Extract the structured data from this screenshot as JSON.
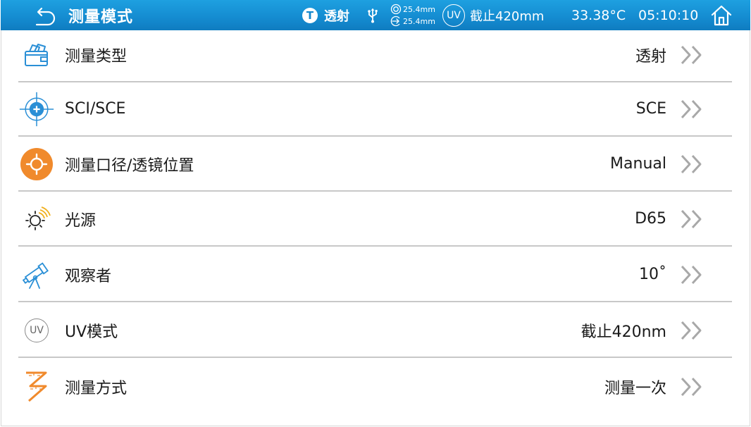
{
  "header": {
    "title": "测量模式",
    "mode_letter": "T",
    "mode_label": "透射",
    "aperture_top": "25.4mm",
    "aperture_bottom": "25.4mm",
    "uv_badge": "UV",
    "uv_label": "截止420mm",
    "temperature": "33.38°C",
    "time": "05:10:10",
    "icons": [
      "back-arrow-icon",
      "usb-icon",
      "aperture-icon",
      "lens-icon",
      "home-icon"
    ]
  },
  "colors": {
    "header_blue": "#148bd0",
    "accent_orange": "#f08a2c",
    "icon_blue": "#2a8fd6",
    "chevron_gray": "#a8a8a8"
  },
  "settings": [
    {
      "label": "测量类型",
      "value": "透射",
      "icon": "measure-type-icon"
    },
    {
      "label": "SCI/SCE",
      "value": "SCE",
      "icon": "target-crosshair-icon"
    },
    {
      "label": "测量口径/透镜位置",
      "value": "Manual",
      "icon": "aperture-position-icon"
    },
    {
      "label": "光源",
      "value": "D65",
      "icon": "light-source-icon"
    },
    {
      "label": "观察者",
      "value": "10˚",
      "icon": "observer-telescope-icon"
    },
    {
      "label": "UV模式",
      "value": "截止420nm",
      "icon": "uv-mode-icon",
      "icon_text": "UV"
    },
    {
      "label": "测量方式",
      "value": "测量一次",
      "icon": "measure-method-icon"
    }
  ]
}
